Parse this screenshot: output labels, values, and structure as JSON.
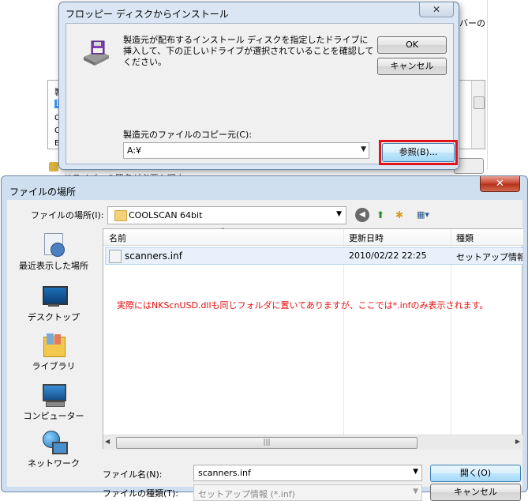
{
  "background": {
    "right_text": "バーの",
    "list_items": [
      "製",
      "E",
      "C",
      "C",
      "E"
    ],
    "shield_text": "ドライバーの署名が必要な理由"
  },
  "floppy_dialog": {
    "title": "フロッピー ディスクからインストール",
    "close_glyph": "✕",
    "message": "製造元が配布するインストール ディスクを指定したドライブに挿入して、下の正しいドライブが選択されていることを確認してください。",
    "ok_label": "OK",
    "cancel_label": "キャンセル",
    "copy_from_label": "製造元のファイルのコピー元(C):",
    "copy_from_value": "A:¥",
    "browse_label": "参照(B)...",
    "highlight_color": "#e0141b"
  },
  "file_dialog": {
    "title": "ファイルの場所",
    "close_glyph": "✕",
    "location_label": "ファイルの場所(I):",
    "location_value": "COOLSCAN 64bit",
    "toolbar": {
      "back_glyph": "◀",
      "up_glyph": "⬆",
      "new_folder_glyph": "✱",
      "view_glyph": "▦▾"
    },
    "places": [
      {
        "label": "最近表示した場所",
        "icon": "recent-places-icon"
      },
      {
        "label": "デスクトップ",
        "icon": "desktop-icon"
      },
      {
        "label": "ライブラリ",
        "icon": "library-icon"
      },
      {
        "label": "コンピューター",
        "icon": "computer-icon"
      },
      {
        "label": "ネットワーク",
        "icon": "network-icon"
      }
    ],
    "columns": {
      "name": "名前",
      "date": "更新日時",
      "type": "種類"
    },
    "files": [
      {
        "name": "scanners.inf",
        "date": "2010/02/22 22:25",
        "type": "セットアップ情報",
        "icon": "inf-file-icon"
      }
    ],
    "annotation": "実際にはNKScnUSD.dllも同じフォルダに置いてありますが、ここでは*.infのみ表示されます。",
    "annotation_color": "#e31010",
    "filename_label": "ファイル名(N):",
    "filename_value": "scanners.inf",
    "filetype_label": "ファイルの種類(T):",
    "filetype_value": "セットアップ情報 (*.inf)",
    "open_label": "開く(O)",
    "cancel_label": "キャンセル"
  }
}
